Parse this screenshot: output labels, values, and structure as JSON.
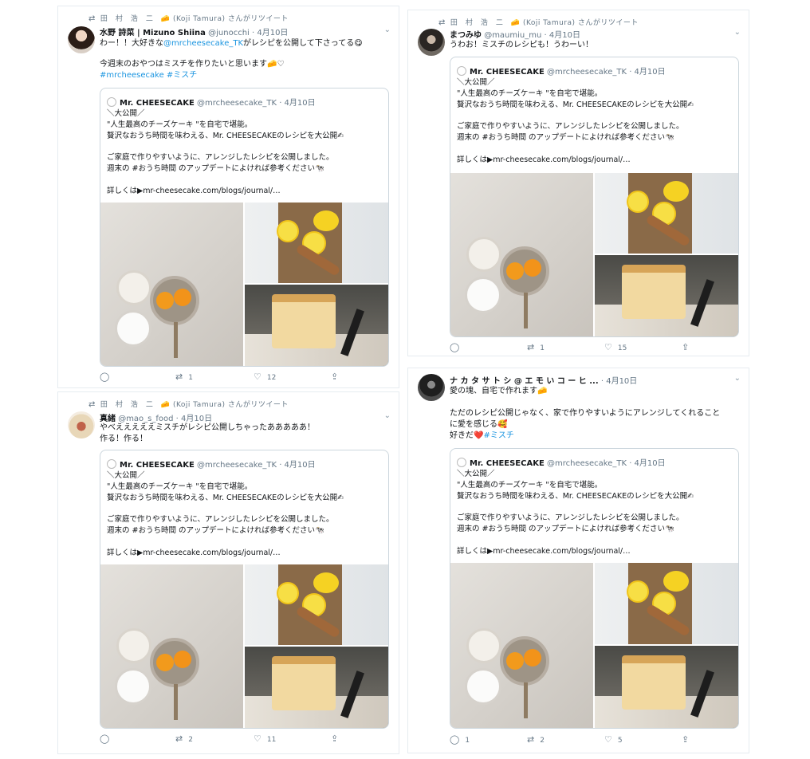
{
  "quote": {
    "name": "Mr. CHEESECAKE",
    "handle": "@mrcheesecake_TK · 4月10日",
    "text": "＼大公開／\n\"人生最高のチーズケーキ \"を自宅で堪能。\n贅沢なおうち時間を味わえる、Mr. CHEESECAKEのレシピを大公開✍\n\nご家庭で作りやすいように、アレンジしたレシピを公開しました。\n週末の #おうち時間 のアップデートによければ参考ください🐄\n\n詳しくは▶mr-cheesecake.com/blogs/journal/…"
  },
  "icons": {
    "retweet": "retweet-icon",
    "reply": "reply-icon",
    "like": "heart-icon",
    "share": "share-icon",
    "more": "chevron-down-icon"
  },
  "colors": {
    "link": "#1b95e0",
    "muted": "#657786",
    "border": "#e6ecf0"
  },
  "tweets": [
    {
      "rt_text": "田　村　浩　二　🧀 (Koji Tamura) さんがリツイート",
      "name": "水野 詩菜 | Mizuno Shiina",
      "handle": "@junocchi · 4月10日",
      "text_1": "わー！！大好きな",
      "mention": "@mrcheesecake_TK",
      "text_2": "がレシピを公開して下さってる😋",
      "text_3": "今週末のおやつはミスチを作りたいと思います🧀♡",
      "hashtags": "#mrcheesecake #ミスチ",
      "reply_count": "",
      "retweet_count": "1",
      "like_count": "12"
    },
    {
      "rt_text": "田　村　浩　二　🧀 (Koji Tamura) さんがリツイート",
      "name": "まつみゆ",
      "handle": "@maumiu_mu · 4月10日",
      "text": "うわお！ミスチのレシピも！うわーい！",
      "reply_count": "",
      "retweet_count": "1",
      "like_count": "15"
    },
    {
      "rt_text": "田　村　浩　二　🧀 (Koji Tamura) さんがリツイート",
      "name": "真緒",
      "handle": "@mao_s_food · 4月10日",
      "text": "やべえええええミスチがレシピ公開しちゃったあああああ！\n作る！作る！",
      "reply_count": "",
      "retweet_count": "2",
      "like_count": "11"
    },
    {
      "name": "ナ カ タ サ ト シ @ エ モ い コ ー ヒ ...",
      "handle": "· 4月10日",
      "text_1": "愛の塊、自宅で作れます🧀\n\nただのレシピ公開じゃなく、家で作りやすいようにアレンジしてくれること\nに愛を感じる🥰\n好きだ❤️",
      "hashtag": "#ミスチ",
      "reply_count": "1",
      "retweet_count": "2",
      "like_count": "5"
    }
  ]
}
